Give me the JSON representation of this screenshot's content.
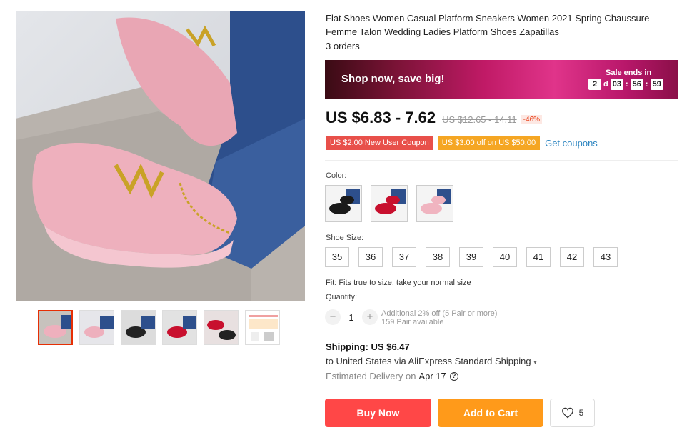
{
  "product": {
    "title": "Flat Shoes Women Casual Platform Sneakers Women 2021 Spring Chaussure Femme Talon Wedding Ladies Platform Shoes Zapatillas",
    "orders": "3 orders"
  },
  "banner": {
    "text": "Shop now, save big!",
    "sale_ends_label": "Sale ends in",
    "countdown": {
      "days": "2",
      "days_unit": "d",
      "hours": "03",
      "minutes": "56",
      "seconds": "59"
    }
  },
  "price": {
    "current": "US $6.83 - 7.62",
    "original": "US $12.65 - 14.11",
    "discount": "-46%"
  },
  "coupons": {
    "new_user": "US $2.00 New User Coupon",
    "store": "US $3.00 off on US $50.00",
    "get_coupons": "Get coupons"
  },
  "color": {
    "label": "Color:",
    "options": [
      "black",
      "red",
      "pink"
    ]
  },
  "size": {
    "label": "Shoe Size:",
    "options": [
      "35",
      "36",
      "37",
      "38",
      "39",
      "40",
      "41",
      "42",
      "43"
    ],
    "fit": "Fit: Fits true to size, take your normal size"
  },
  "quantity": {
    "label": "Quantity:",
    "value": "1",
    "minus": "−",
    "plus": "+",
    "discount_note": "Additional 2% off (5 Pair or more)",
    "available": "159 Pair available"
  },
  "shipping": {
    "title": "Shipping: US $6.47",
    "to": "to United States via AliExpress Standard Shipping",
    "delivery_label": "Estimated Delivery on",
    "delivery_date": "Apr 17"
  },
  "actions": {
    "buy_now": "Buy Now",
    "add_to_cart": "Add to Cart",
    "wishlist_count": "5"
  },
  "colors": {
    "price_red": "#e62e04",
    "buy_button": "#ff4747",
    "cart_button": "#ff9a1a",
    "link_blue": "#2e86c1"
  }
}
